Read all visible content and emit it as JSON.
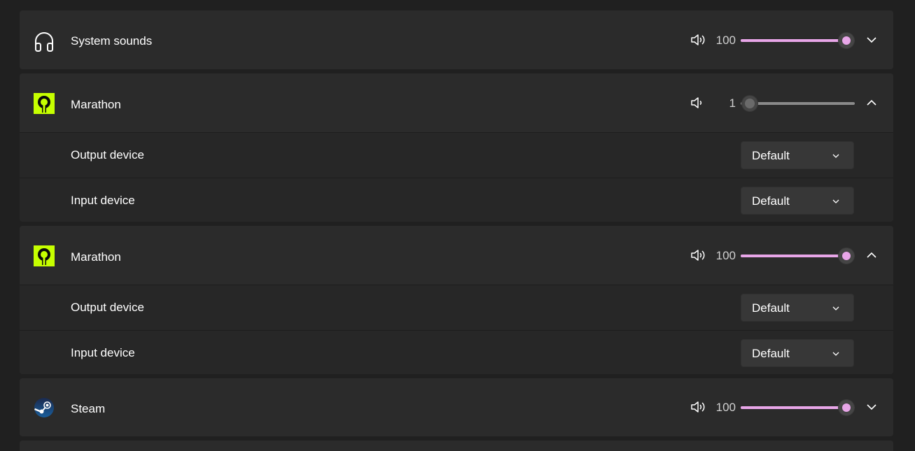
{
  "apps": [
    {
      "name": "System sounds",
      "icon": "headphones-icon",
      "volume": "100",
      "volume_level": 1.0,
      "speaker_icon": "speaker-loud-icon",
      "expanded": false
    },
    {
      "name": "Marathon",
      "icon": "marathon-app-icon",
      "volume": "1",
      "volume_level": 0.01,
      "speaker_icon": "speaker-quiet-icon",
      "expanded": true,
      "output_device_label": "Output device",
      "output_device_value": "Default",
      "input_device_label": "Input device",
      "input_device_value": "Default"
    },
    {
      "name": "Marathon",
      "icon": "marathon-app-icon",
      "volume": "100",
      "volume_level": 1.0,
      "speaker_icon": "speaker-loud-icon",
      "expanded": true,
      "output_device_label": "Output device",
      "output_device_value": "Default",
      "input_device_label": "Input device",
      "input_device_value": "Default"
    },
    {
      "name": "Steam",
      "icon": "steam-app-icon",
      "volume": "100",
      "volume_level": 1.0,
      "speaker_icon": "speaker-loud-icon",
      "expanded": false
    }
  ],
  "colors": {
    "accent": "#e8a6e8",
    "marathon_brand": "#c6ff00",
    "background": "#202020",
    "card": "#2b2b2b"
  }
}
